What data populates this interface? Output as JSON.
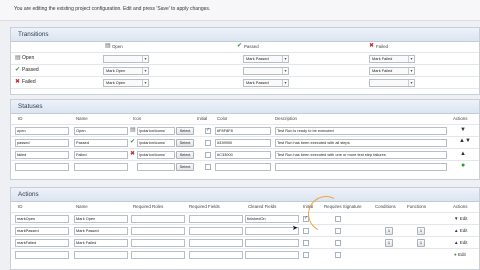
{
  "notice": "You are editing the existing project configuration. Edit and press 'Save' to apply changes.",
  "transitions": {
    "title": "Transitions",
    "columns": [
      "Open",
      "Passed",
      "Failed"
    ],
    "rows": [
      {
        "label": "Open",
        "cells": [
          "",
          "Mark Passed",
          "Mark Failed"
        ]
      },
      {
        "label": "Passed",
        "cells": [
          "Mark Open",
          "",
          "Mark Failed"
        ]
      },
      {
        "label": "Failed",
        "cells": [
          "Mark Open",
          "Mark Passed",
          ""
        ]
      }
    ]
  },
  "statuses": {
    "title": "Statuses",
    "headers": [
      "ID",
      "Name",
      "Icon",
      "Initial",
      "Color",
      "Description"
    ],
    "rows": [
      {
        "id": "open",
        "name": "Open",
        "icon": "/polarion/icons/",
        "color": "#F8F8F8",
        "description": "Test Run is ready to be executed"
      },
      {
        "id": "passed",
        "name": "Passed",
        "icon": "/polarion/icons/",
        "color": "#339900",
        "description": "Test Run has been executed with all steps"
      },
      {
        "id": "failed",
        "name": "Failed",
        "icon": "/polarion/icons/",
        "color": "#C33000",
        "description": "Test Run has been executed with one or more test step failures"
      }
    ],
    "select_label": "Select",
    "actions_header": "Actions"
  },
  "actions": {
    "title": "Actions",
    "headers": [
      "ID",
      "Name",
      "Required Roles",
      "Required Fields",
      "Cleared Fields",
      "Initial",
      "Requires Signature",
      "Conditions",
      "Functions",
      "Actions"
    ],
    "rows": [
      {
        "id": "markOpen",
        "name": "Mark Open",
        "cleared": "finishedOn",
        "edit": "Edit"
      },
      {
        "id": "markPassed",
        "name": "Mark Passed",
        "cleared": "",
        "edit": "Edit"
      },
      {
        "id": "markFailed",
        "name": "Mark Failed",
        "cleared": "",
        "edit": "Edit"
      },
      {
        "id": "",
        "name": "",
        "cleared": "",
        "edit": "Edit"
      }
    ],
    "count_label": "1"
  }
}
